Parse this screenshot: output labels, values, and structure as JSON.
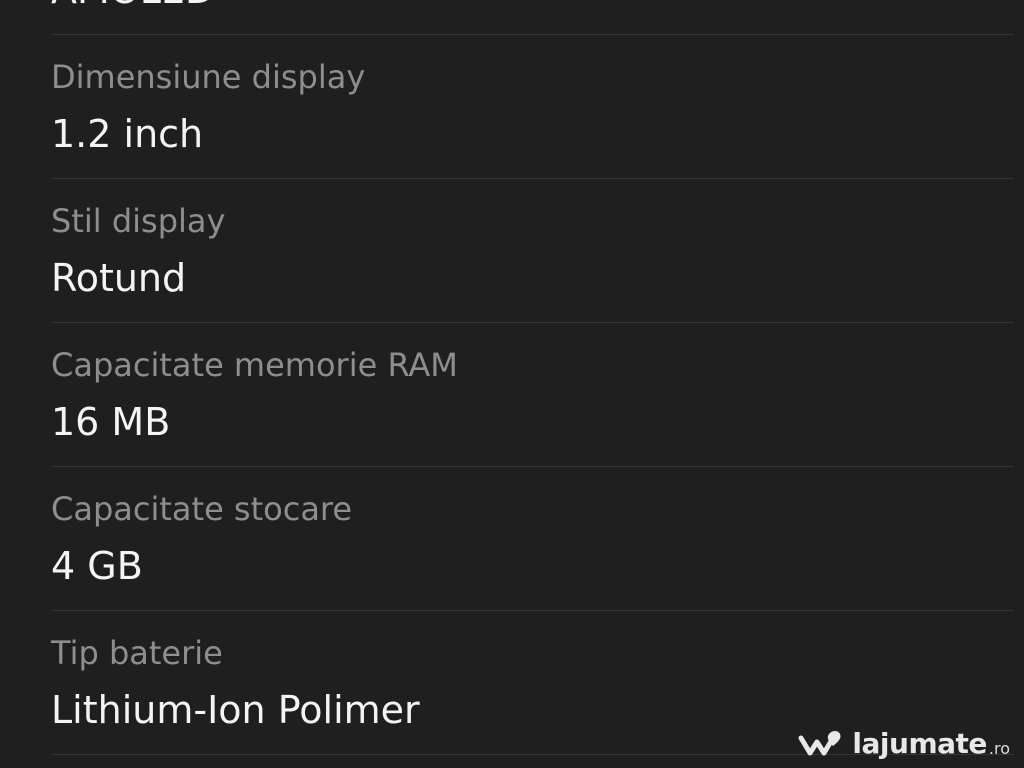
{
  "specs": [
    {
      "label": "",
      "value": "AMOLED"
    },
    {
      "label": "Dimensiune display",
      "value": "1.2 inch"
    },
    {
      "label": "Stil display",
      "value": "Rotund"
    },
    {
      "label": "Capacitate memorie RAM",
      "value": "16 MB"
    },
    {
      "label": "Capacitate stocare",
      "value": "4 GB"
    },
    {
      "label": "Tip baterie",
      "value": "Lithium-Ion Polimer"
    }
  ],
  "watermark": {
    "brand": "lajumate",
    "tld": ".ro"
  },
  "colors": {
    "background": "#1f1f1f",
    "label": "#8e8e8e",
    "value": "#f4f4f4",
    "divider": "#353535"
  }
}
